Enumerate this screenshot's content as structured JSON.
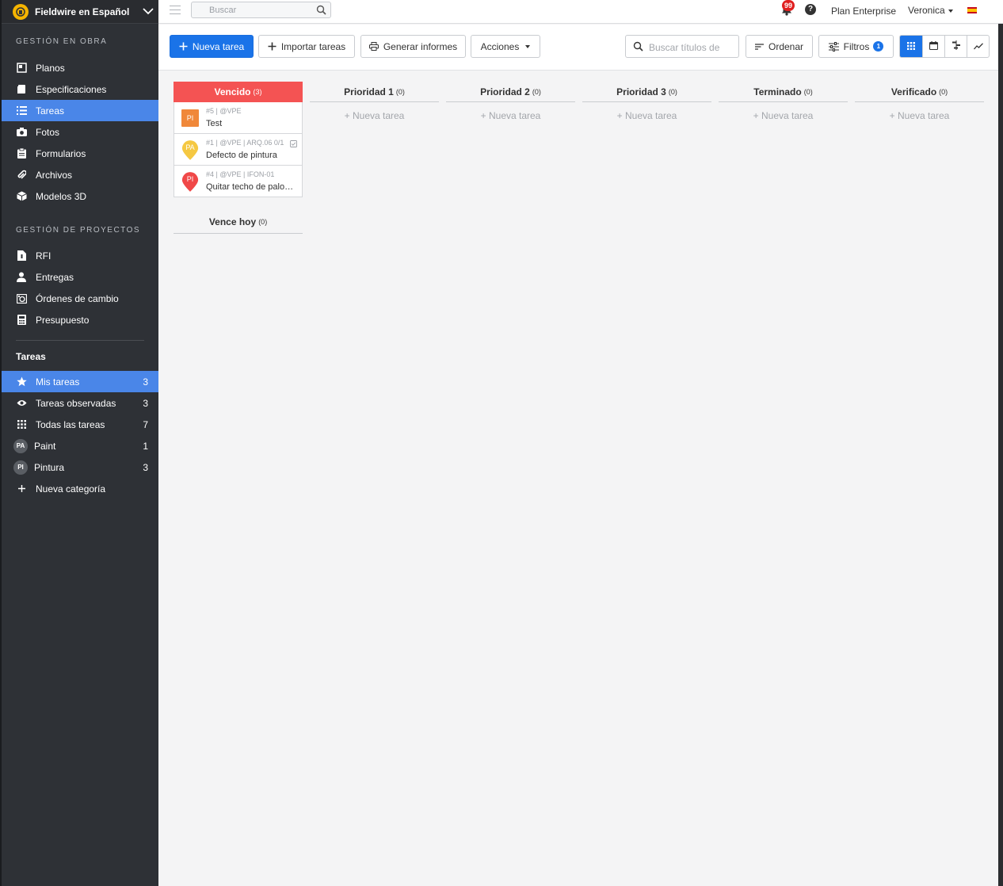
{
  "app": {
    "name": "Fieldwire en Español"
  },
  "sidebar": {
    "section_obra": "GESTIÓN EN OBRA",
    "obra_items": [
      {
        "label": "Planos",
        "icon": "plans-icon"
      },
      {
        "label": "Especificaciones",
        "icon": "specs-icon"
      },
      {
        "label": "Tareas",
        "icon": "list-icon",
        "active": true
      },
      {
        "label": "Fotos",
        "icon": "camera-icon"
      },
      {
        "label": "Formularios",
        "icon": "clipboard-icon"
      },
      {
        "label": "Archivos",
        "icon": "paperclip-icon"
      },
      {
        "label": "Modelos 3D",
        "icon": "cube-icon"
      }
    ],
    "section_proyectos": "GESTIÓN DE PROYECTOS",
    "proyecto_items": [
      {
        "label": "RFI",
        "icon": "rfi-doc-icon"
      },
      {
        "label": "Entregas",
        "icon": "person-icon"
      },
      {
        "label": "Órdenes de cambio",
        "icon": "change-order-icon"
      },
      {
        "label": "Presupuesto",
        "icon": "calculator-icon"
      }
    ],
    "tareas_title": "Tareas",
    "tareas_items": [
      {
        "label": "Mis tareas",
        "count": "3",
        "icon": "star-icon",
        "active": true
      },
      {
        "label": "Tareas observadas",
        "count": "3",
        "icon": "eye-icon"
      },
      {
        "label": "Todas las tareas",
        "count": "7",
        "icon": "grid-dots-icon"
      },
      {
        "label": "Paint",
        "count": "1",
        "badge": "PA"
      },
      {
        "label": "Pintura",
        "count": "3",
        "badge": "PI"
      },
      {
        "label": "Nueva categoría",
        "icon": "plus-icon"
      }
    ]
  },
  "topbar": {
    "search_placeholder": "Buscar",
    "notifications": "99",
    "help": "?",
    "plan": "Plan Enterprise",
    "user": "Veronica"
  },
  "toolbar": {
    "new_task": "Nueva tarea",
    "import": "Importar tareas",
    "reports": "Generar informes",
    "actions": "Acciones",
    "search_placeholder": "Buscar títulos de",
    "sort": "Ordenar",
    "filters": "Filtros",
    "filters_count": "1"
  },
  "board": {
    "new_task_label": "+ Nueva tarea",
    "columns": [
      {
        "title": "Vencido",
        "count": "(3)"
      },
      {
        "title": "Prioridad 1",
        "count": "(0)"
      },
      {
        "title": "Prioridad 2",
        "count": "(0)"
      },
      {
        "title": "Prioridad 3",
        "count": "(0)"
      },
      {
        "title": "Terminado",
        "count": "(0)"
      },
      {
        "title": "Verificado",
        "count": "(0)"
      }
    ],
    "vence_hoy": {
      "title": "Vence hoy",
      "count": "(0)"
    },
    "cards": [
      {
        "initials": "PI",
        "meta": "#5 | @VPE",
        "title": "Test",
        "color": "#f0883a",
        "shape": "square"
      },
      {
        "initials": "PA",
        "meta": "#1 | @VPE | ARQ.06 0/1",
        "title": "Defecto de pintura",
        "color": "#f5c842",
        "shape": "pin"
      },
      {
        "initials": "PI",
        "meta": "#4 | @VPE | IFON-01",
        "title": "Quitar techo de palomar",
        "color": "#f04848",
        "shape": "pin"
      }
    ]
  },
  "colors": {
    "accent": "#1a73e8",
    "sidebar_bg": "#2e3136",
    "sidebar_active": "#4a86e8",
    "overdue": "#f45353"
  }
}
